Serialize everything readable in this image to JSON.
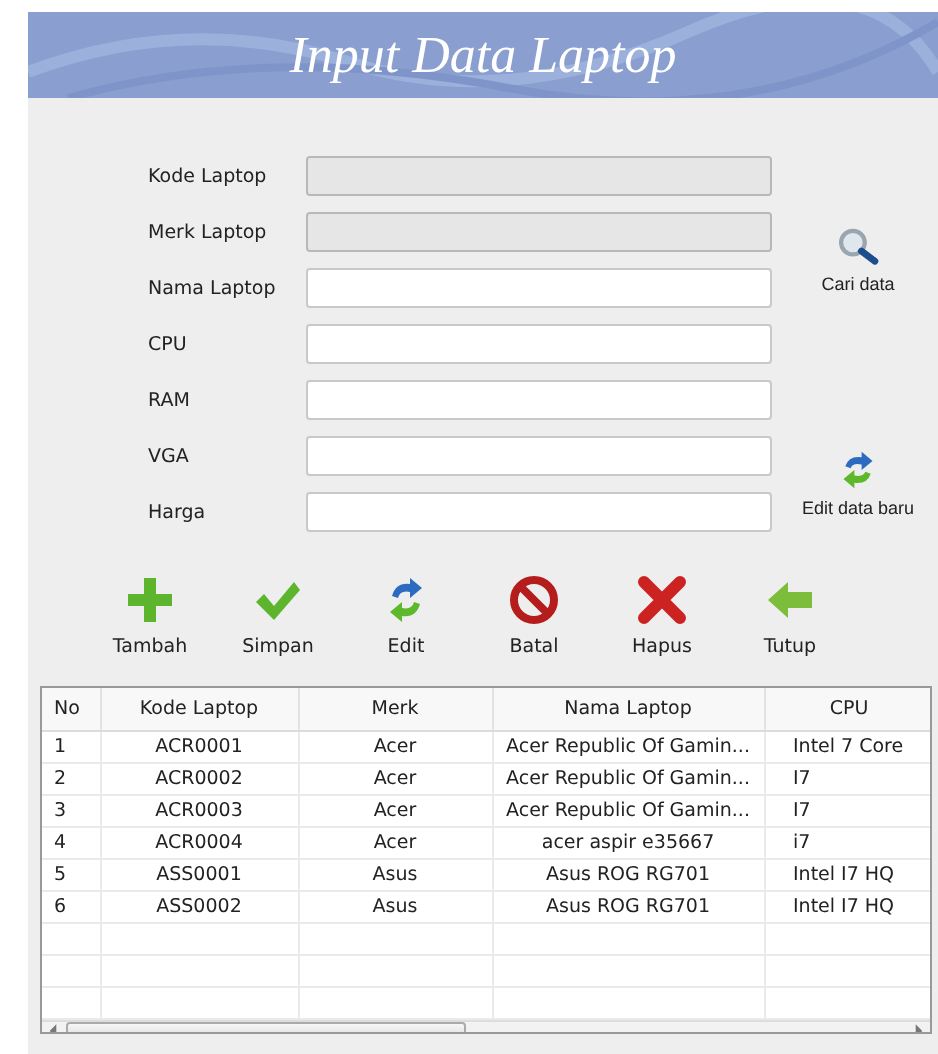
{
  "header": {
    "title": "Input Data Laptop"
  },
  "form": {
    "fields": [
      {
        "label": "Kode Laptop",
        "disabled": true
      },
      {
        "label": "Merk Laptop",
        "disabled": true
      },
      {
        "label": "Nama Laptop",
        "disabled": false
      },
      {
        "label": "CPU",
        "disabled": false
      },
      {
        "label": "RAM",
        "disabled": false
      },
      {
        "label": "VGA",
        "disabled": false
      },
      {
        "label": "Harga",
        "disabled": false
      }
    ],
    "side_buttons": [
      {
        "kind": "search",
        "label": "Cari data"
      },
      {
        "kind": "refresh",
        "label": "Edit data baru"
      }
    ]
  },
  "toolbar": [
    {
      "kind": "add",
      "label": "Tambah"
    },
    {
      "kind": "save",
      "label": "Simpan"
    },
    {
      "kind": "edit",
      "label": "Edit"
    },
    {
      "kind": "cancel",
      "label": "Batal"
    },
    {
      "kind": "delete",
      "label": "Hapus"
    },
    {
      "kind": "close",
      "label": "Tutup"
    }
  ],
  "table": {
    "columns": [
      "No",
      "Kode Laptop",
      "Merk",
      "Nama Laptop",
      "CPU"
    ],
    "rows": [
      [
        "1",
        "ACR0001",
        "Acer",
        "Acer Republic Of Gamin...",
        "Intel 7 Core"
      ],
      [
        "2",
        "ACR0002",
        "Acer",
        "Acer Republic Of Gamin...",
        "I7"
      ],
      [
        "3",
        "ACR0003",
        "Acer",
        "Acer Republic Of Gamin...",
        "I7"
      ],
      [
        "4",
        "ACR0004",
        "Acer",
        "acer aspir e35667",
        "i7"
      ],
      [
        "5",
        "ASS0001",
        "Asus",
        "Asus ROG RG701",
        "Intel I7 HQ"
      ],
      [
        "6",
        "ASS0002",
        "Asus",
        "Asus ROG RG701",
        "Intel I7 HQ"
      ]
    ]
  }
}
